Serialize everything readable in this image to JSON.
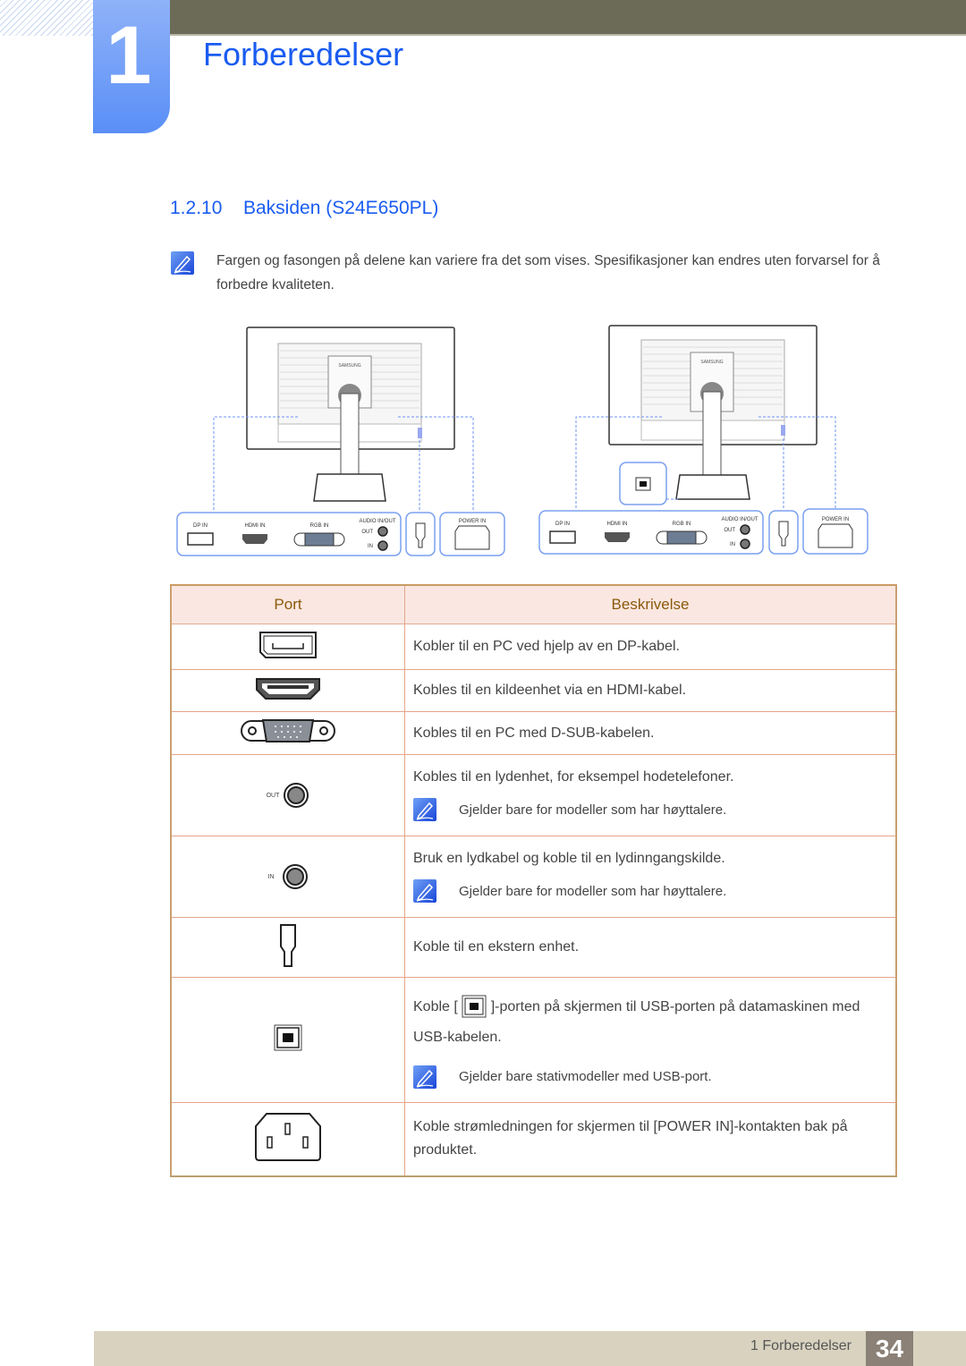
{
  "header": {
    "chapter_number": "1",
    "chapter_title": "Forberedelser"
  },
  "section": {
    "number": "1.2.10",
    "title": "Baksiden (S24E650PL)"
  },
  "intro_note": {
    "icon": "note-pencil-icon",
    "text": "Fargen og fasongen på delene kan variere fra det som vises. Spesifikasjoner kan endres uten forvarsel for å forbedre kvaliteten."
  },
  "figures": {
    "port_labels": {
      "dp_in": "DP IN",
      "hdmi_in": "HDMI IN",
      "rgb_in": "RGB IN",
      "audio_in_out": "AUDIO IN/OUT",
      "out": "OUT",
      "in": "IN",
      "power_in": "POWER IN"
    },
    "brand": "SAMSUNG"
  },
  "table": {
    "headers": [
      "Port",
      "Beskrivelse"
    ],
    "rows": [
      {
        "port_icon": "displayport-icon",
        "description": "Kobler til en PC ved hjelp av en DP-kabel."
      },
      {
        "port_icon": "hdmi-port-icon",
        "description": "Kobles til en kildeenhet via en HDMI-kabel."
      },
      {
        "port_icon": "vga-dsub-port-icon",
        "description": "Kobles til en PC med D-SUB-kabelen."
      },
      {
        "port_icon": "audio-out-jack-icon",
        "port_label": "OUT",
        "description": "Kobles til en lydenhet, for eksempel hodetelefoner.",
        "note": "Gjelder bare for modeller som har høyttalere."
      },
      {
        "port_icon": "audio-in-jack-icon",
        "port_label": "IN",
        "description": "Bruk en lydkabel og koble til en lydinngangskilde.",
        "note": "Gjelder bare for modeller som har høyttalere."
      },
      {
        "port_icon": "kensington-lock-icon",
        "description": "Koble til en ekstern enhet."
      },
      {
        "port_icon": "usb-b-port-icon",
        "description_before": "Koble [",
        "description_after": "]-porten på skjermen til USB-porten på datamaskinen med USB-kabelen.",
        "note": "Gjelder bare stativmodeller med USB-port."
      },
      {
        "port_icon": "power-in-socket-icon",
        "description": "Koble strømledningen for skjermen til [POWER IN]-kontakten bak på produktet."
      }
    ]
  },
  "footer": {
    "label": "1 Forberedelser",
    "page_number": "34"
  }
}
